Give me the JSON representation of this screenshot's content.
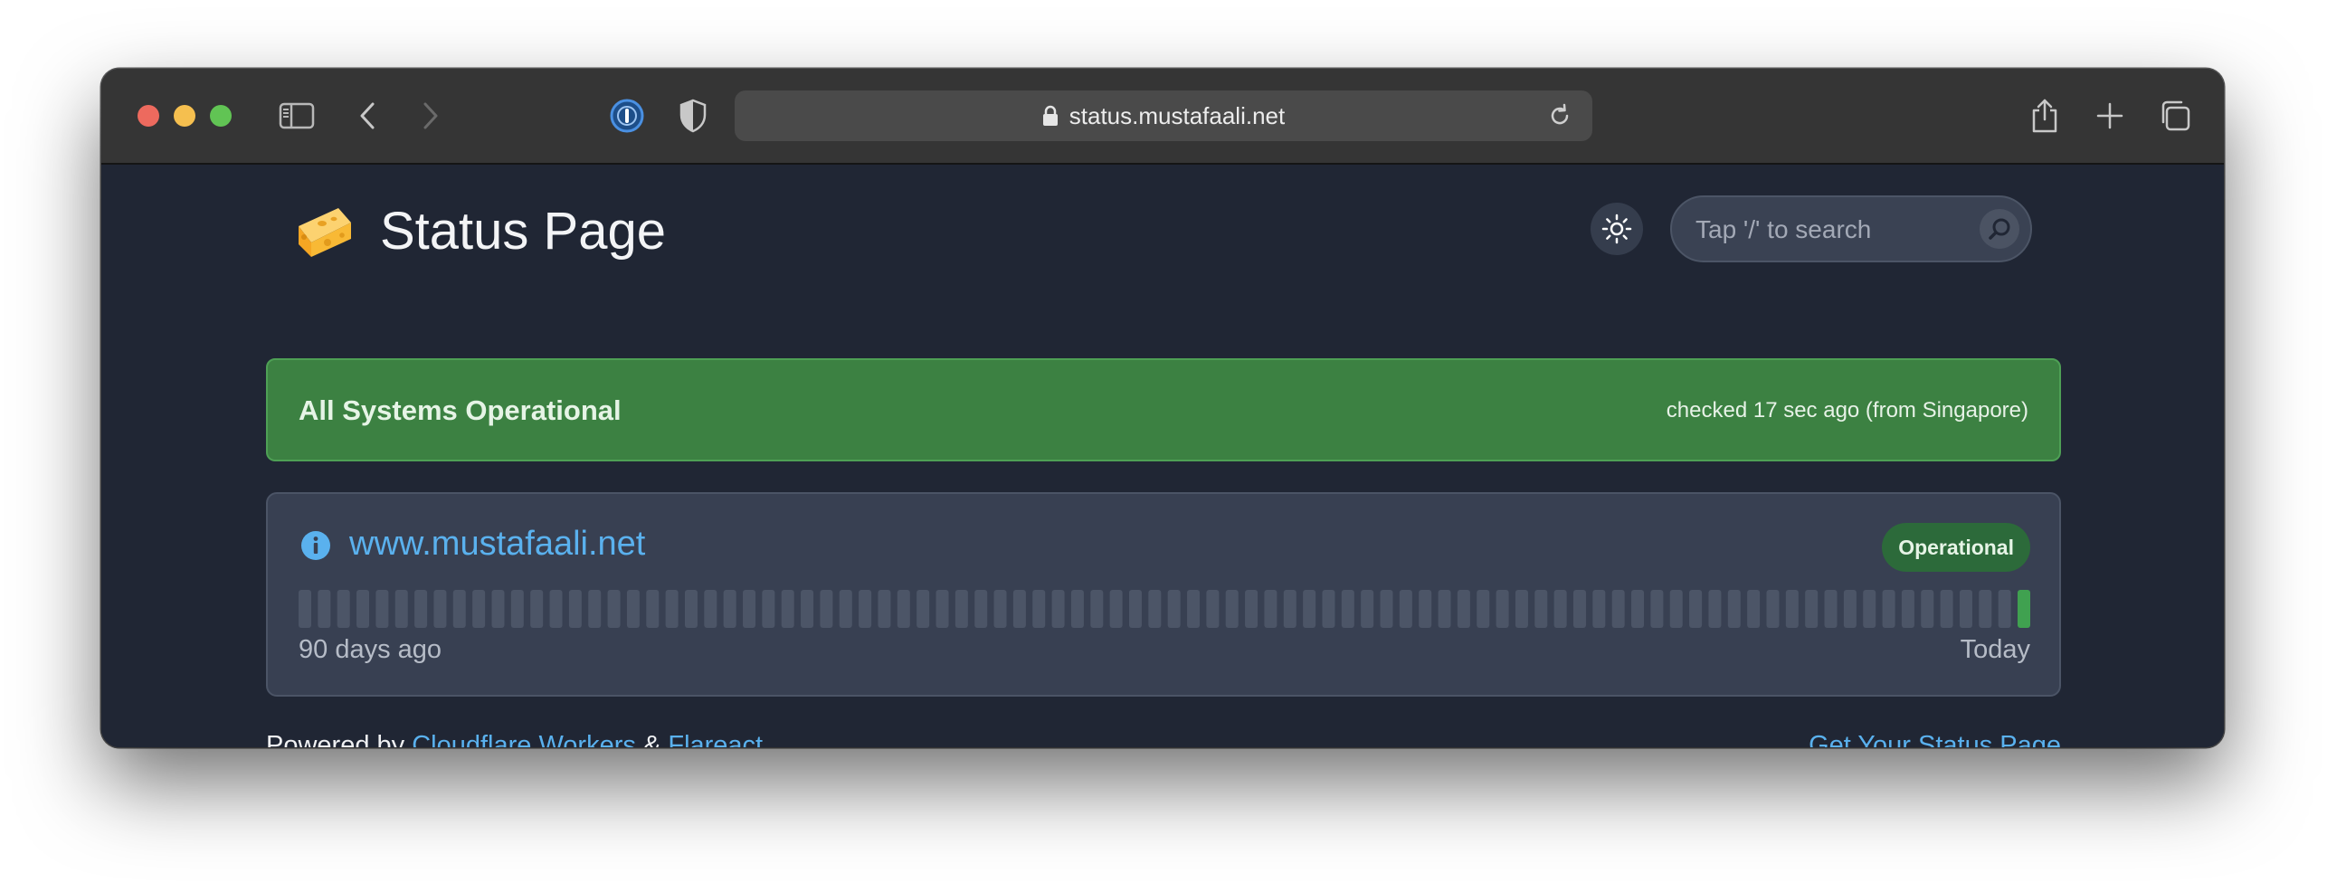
{
  "browser": {
    "url": "status.mustafaali.net",
    "icons": [
      "sidebar-icon",
      "back-icon",
      "forward-icon",
      "password-manager-icon",
      "shield-icon",
      "lock-icon",
      "reload-icon",
      "share-icon",
      "new-tab-icon",
      "tab-overview-icon"
    ]
  },
  "header": {
    "logo": "🧀",
    "title": "Status Page",
    "theme_icon": "sun-icon",
    "search_placeholder": "Tap '/' to search"
  },
  "banner": {
    "title": "All Systems Operational",
    "checked": "checked 17 sec ago (from Singapore)",
    "color": "#3c8142"
  },
  "monitor": {
    "name": "www.mustafaali.net",
    "status": "Operational",
    "days_total": 90,
    "days_with_data": 1,
    "range_start": "90 days ago",
    "range_end": "Today",
    "up_color": "#40a150",
    "nodata_color": "#4c5567"
  },
  "footer": {
    "powered_prefix": "Powered by",
    "link1": "Cloudflare Workers",
    "separator": "&",
    "link2": "Flareact",
    "cta": "Get Your Status Page"
  },
  "colors": {
    "background": "#202634",
    "link": "#5ab1ee"
  }
}
